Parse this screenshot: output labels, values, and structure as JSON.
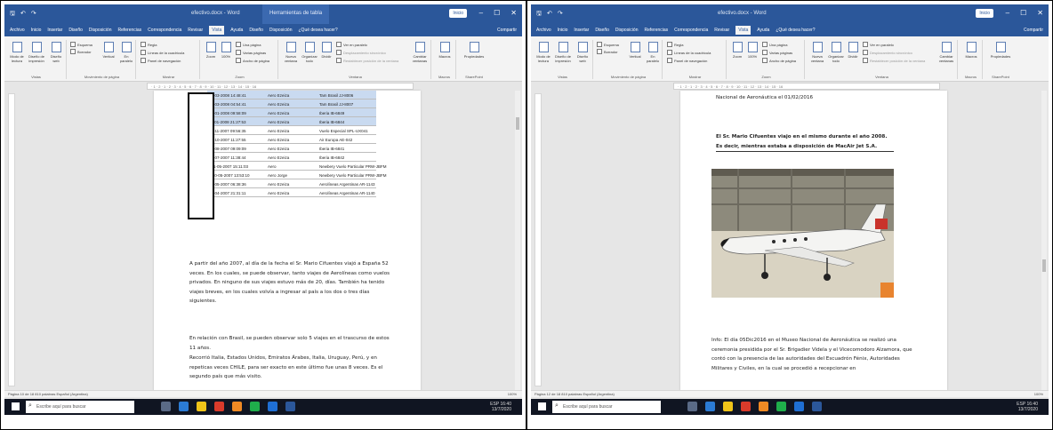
{
  "word": {
    "title": "efectivo.docx - Word",
    "context_tab": "Herramientas de tabla",
    "user": "Inicio",
    "tabs": [
      "Archivo",
      "Inicio",
      "Insertar",
      "Diseño",
      "Disposición",
      "Referencias",
      "Correspondencia",
      "Revisar",
      "Vista",
      "Ayuda",
      "Diseño",
      "Disposición"
    ],
    "tell_me": "¿Qué desea hacer?",
    "share": "Compartir",
    "ribbon": {
      "views": [
        "Modo de lectura",
        "Diseño de impresión",
        "Diseño web"
      ],
      "views_label": "Vistas",
      "movement": [
        "Esquema",
        "Borrador",
        "Vertical",
        "En paralelo"
      ],
      "movement_label": "Movimiento de página",
      "show": [
        "Regla",
        "Líneas de la cuadrícula",
        "Panel de navegación"
      ],
      "show_label": "Mostrar",
      "zoom": [
        "Zoom",
        "100%",
        "Una página",
        "Varias páginas",
        "Ancho de página"
      ],
      "zoom_label": "Zoom",
      "window": [
        "Nueva ventana",
        "Organizar todo",
        "Dividir",
        "Ver en paralelo",
        "Desplazamiento sincrónico",
        "Restablecer posición de la ventana",
        "Cambiar ventanas"
      ],
      "window_label": "Ventana",
      "macros": "Macros",
      "macros_label": "Macros",
      "sharepoint": "Propiedades",
      "sharepoint_label": "SharePoint"
    },
    "status": {
      "p1": "Página 10 de 18   810 palabras   Español (Argentina)",
      "p2": "Página 12 de 18   810 palabras   Español (Argentina)",
      "zoom": "100%"
    }
  },
  "doc1": {
    "rows": [
      [
        "29-03-2008 14:48:41",
        "Aero Ezeiza",
        "Tam Brasil   JJ-8006"
      ],
      [
        "29-03-2008 04:54:41",
        "Aero Ezeiza",
        "Tam Brasil   JJ-8007"
      ],
      [
        "22-01-2008 09:58:09",
        "Aero Ezeiza",
        "Iberia   IB-6849"
      ],
      [
        "11-01-2008 21:27:53",
        "Aero Ezeiza",
        "Iberia   IB-6844"
      ],
      [
        "07-11-2007 09:56:35",
        "Aero Ezeiza",
        "Vuelo Especial   SPL-UX041"
      ],
      [
        "29-10-2007 11:27:55",
        "Aero Ezeiza",
        "Air Europa   AE-042"
      ],
      [
        "10-08-2007 09:09:09",
        "Aero Ezeiza",
        "Iberia   IB-6841"
      ],
      [
        "19-07-2007 11:38:44",
        "Aero Ezeiza",
        "Iberia   IB-6842"
      ],
      [
        "I 21-05-2007 15:11:03",
        "Aero",
        "Newbery   Vuelo Particular   PRW-JBFM"
      ],
      [
        "5 20-05-2007 13:53:10",
        "Aero Jorge",
        "Newbery   Vuelo Particular   PRW-JBFM"
      ],
      [
        "02-05-2007 06:38:36",
        "Aero Ezeiza",
        "Aerolíneas Argentinas   AR-1143"
      ],
      [
        "28-04-2007 21:31:11",
        "Aero Ezeiza",
        "Aerolíneas Argentinas   AR-1140"
      ]
    ],
    "paragraphs": [
      "A partir del año 2007, al día de la fecha el Sr. Mario Cifuentes viajó a España 52 veces. En los cuales, se puede observar, tanto viajes de Aerolíneas como vuelos privados. En ninguno de sus viajes estuvo más de 20, días. También ha tenido viajes breves, en los cuales volvía a ingresar al país a los dos o tres días siguientes.",
      "En relación con Brasil, se pueden observar solo 5 viajes en el trascurso de estos 11 años.",
      "Recorrió Italia, Estados Unidos, Emiratos Árabes, Italia, Uruguay, Perú, y en repeticas veces CHILE, para ser exacto en este último fue unas 8 veces. Es el segundo país que más visito."
    ]
  },
  "doc2": {
    "top_line": "Nacional de Aeronáutica el 01/02/2016",
    "heading": "El Sr. Mario Cifuentes viajo en el mismo durante el año 2008. Es decir, mientras estaba a disposición de MacAir Jet S.A.",
    "info": "Info: El día 05Dic2016 en el Museo Nacional de Aeronáutica se realizó una ceremonia presidida por el Sr. Brigadier Videla y el Vicecomodoro Alzamora, que contó con la presencia de las autoridades del Escuadrón Fénix, Autoridades Militares y Civiles, en la cual se procedió a recepcionar en"
  },
  "taskbar": {
    "search": "Escribe aquí para buscar",
    "time1": "16:40",
    "date1": "13/7/2020",
    "time2": "16:40",
    "date2": "13/7/2020",
    "lang": "ESP"
  },
  "colors": {
    "word_blue": "#2b579a",
    "highlight": "#c9daf0"
  }
}
